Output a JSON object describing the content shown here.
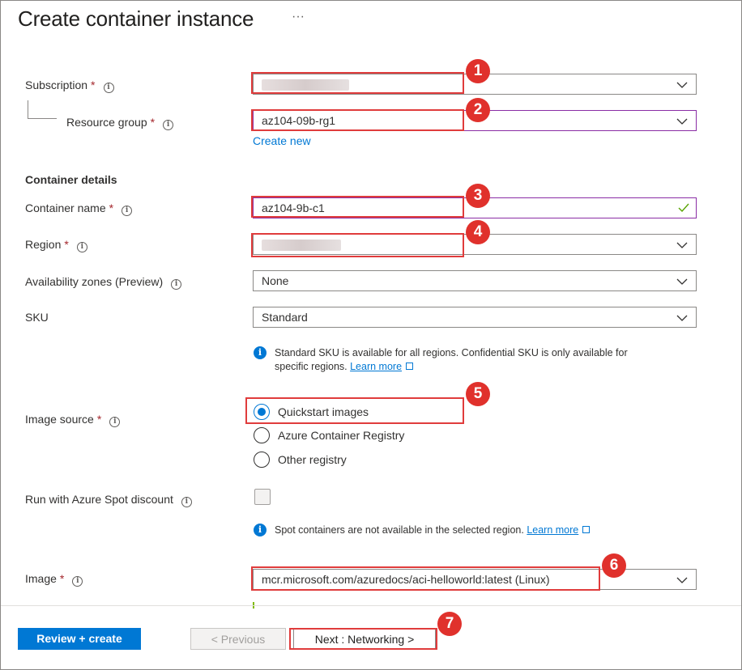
{
  "page": {
    "title": "Create container instance",
    "more_glyph": "···"
  },
  "fields": {
    "subscription": {
      "label": "Subscription",
      "value": ""
    },
    "resource_group": {
      "label": "Resource group",
      "value": "az104-09b-rg1",
      "create_new": "Create new"
    },
    "container_details_heading": "Container details",
    "container_name": {
      "label": "Container name",
      "value": "az104-9b-c1"
    },
    "region": {
      "label": "Region",
      "value": ""
    },
    "availability_zones": {
      "label": "Availability zones (Preview)",
      "value": "None"
    },
    "sku": {
      "label": "SKU",
      "value": "Standard"
    },
    "sku_info": {
      "text": "Standard SKU is available for all regions. Confidential SKU is only available for",
      "text2": "specific regions.",
      "link": "Learn more"
    },
    "image_source": {
      "label": "Image source",
      "options": [
        "Quickstart images",
        "Azure Container Registry",
        "Other registry"
      ],
      "selected": "Quickstart images"
    },
    "spot": {
      "label": "Run with Azure Spot discount",
      "checked": false
    },
    "spot_info": {
      "text": "Spot containers are not available in the selected region.",
      "link": "Learn more"
    },
    "image": {
      "label": "Image",
      "value": "mcr.microsoft.com/azuredocs/aci-helloworld:latest (Linux)"
    }
  },
  "required_marker": "*",
  "info_glyph": "i",
  "footer": {
    "review_create": "Review + create",
    "previous": "< Previous",
    "next": "Next : Networking >"
  },
  "annotations": [
    "1",
    "2",
    "3",
    "4",
    "5",
    "6",
    "7"
  ],
  "colors": {
    "accent": "#0078d4",
    "annotation": "#e03c3c",
    "focus_border": "#8a2da5",
    "required": "#a4262c"
  }
}
